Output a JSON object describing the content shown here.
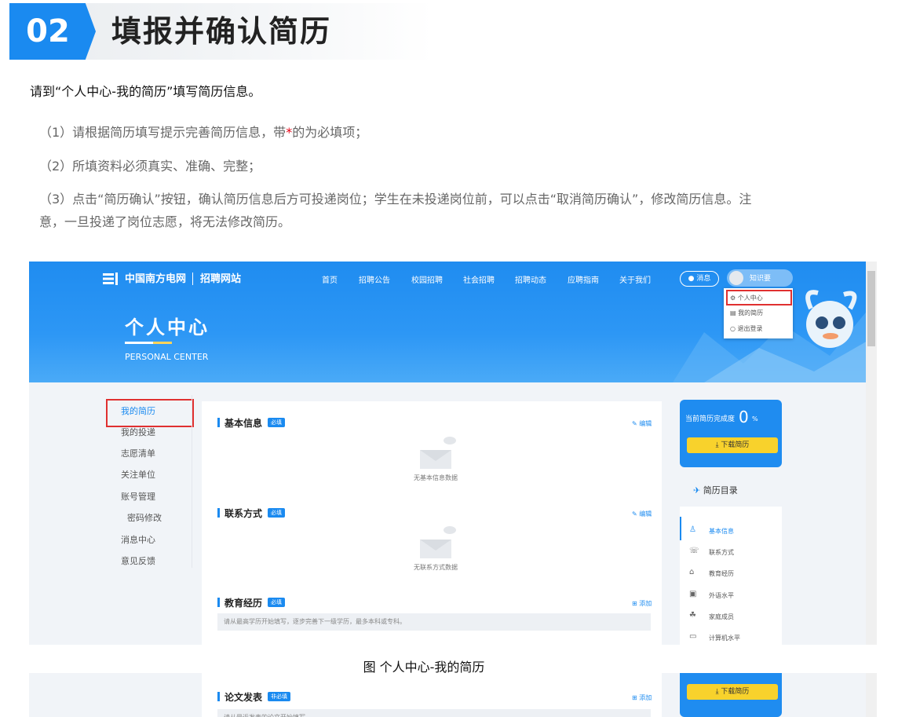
{
  "step": {
    "number": "02",
    "title": "填报并确认简历"
  },
  "intro": "请到“个人中心-我的简历”填写简历信息。",
  "items": {
    "item1_pre": "（1）请根据简历填写提示完善简历信息，带",
    "item1_star": "*",
    "item1_post": "的为必填项；",
    "item2": "（2）所填资料必须真实、准确、完整；",
    "item3_line1": "（3）点击“简历确认”按钮，确认简历信息后方可投递岗位；学生在未投递岗位前，可以点击“取消简历确认”，修改简历信息。注",
    "item3_line2": "意，一旦投递了岗位志愿，将无法修改简历。"
  },
  "screenshot": {
    "logo_text": "中国南方电网",
    "logo_sub": "招聘网站",
    "nav": [
      "首页",
      "招聘公告",
      "校园招聘",
      "社会招聘",
      "招聘动态",
      "应聘指南",
      "关于我们"
    ],
    "msg_label": "消息",
    "user_name": "知识要",
    "dropdown": [
      "个人中心",
      "我的简历",
      "退出登录"
    ],
    "page_title": "个人中心",
    "page_subtitle": "PERSONAL CENTER",
    "sidebar": [
      "我的简历",
      "我的投递",
      "志愿清单",
      "关注单位",
      "账号管理",
      "密码修改",
      "消息中心",
      "意见反馈"
    ],
    "sections": {
      "basic": {
        "title": "基本信息",
        "tag": "必填",
        "edit": "编辑",
        "empty": "无基本信息数据"
      },
      "contact": {
        "title": "联系方式",
        "tag": "必填",
        "edit": "编辑",
        "empty": "无联系方式数据"
      },
      "education": {
        "title": "教育经历",
        "tag": "必填",
        "add": "添加",
        "hint": "请从最高学历开始填写，逐步完善下一级学历，最多本科或专科。"
      }
    },
    "completion": {
      "label": "当前简历完成度",
      "value": "0",
      "unit": "%",
      "download": "下载简历"
    },
    "toc": {
      "title": "简历目录",
      "items": [
        "基本信息",
        "联系方式",
        "教育经历",
        "外语水平",
        "家庭成员",
        "计算机水平"
      ]
    }
  },
  "caption": "图 个人中心-我的简历",
  "screenshot2": {
    "section_title": "论文发表",
    "tag": "非必填",
    "add": "添加",
    "hint": "请从最近发表的论文开始填写。",
    "download": "下载简历"
  }
}
